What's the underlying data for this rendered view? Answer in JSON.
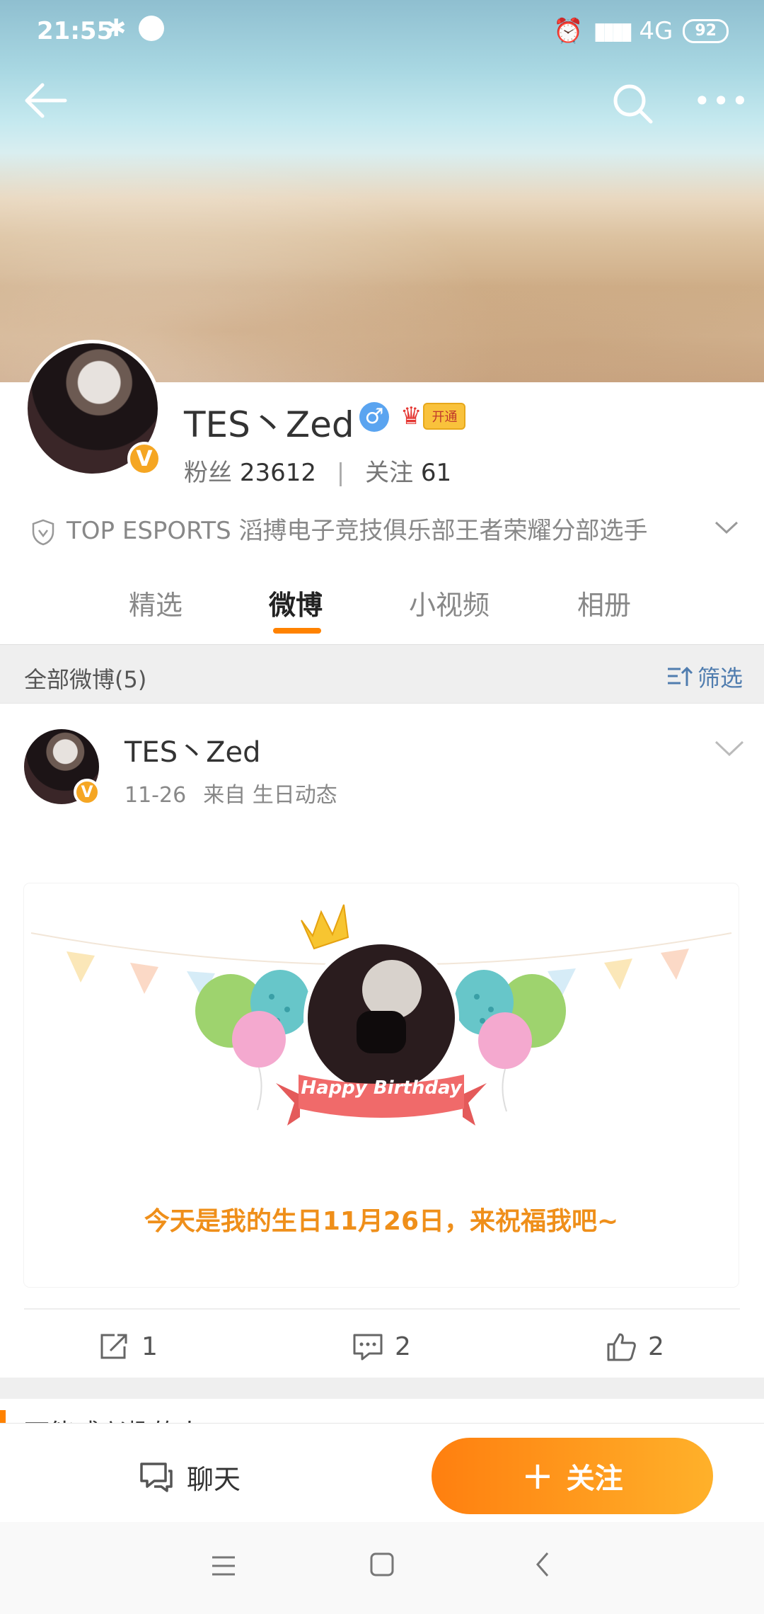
{
  "status_bar": {
    "time": "21:55",
    "network": "4G",
    "battery": "92"
  },
  "profile": {
    "name": "TES丶Zed",
    "vip_label": "开通",
    "fans_label": "粉丝",
    "fans_count": "23612",
    "following_label": "关注",
    "following_count": "61",
    "description": "TOP ESPORTS 滔搏电子竞技俱乐部王者荣耀分部选手",
    "verified_badge": "V"
  },
  "tabs": [
    "精选",
    "微博",
    "小视频",
    "相册"
  ],
  "active_tab": "微博",
  "section": {
    "title": "全部微博(5)",
    "filter_label": "筛选"
  },
  "post": {
    "author": "TES丶Zed",
    "date": "11-26",
    "source": "来自 生日动态",
    "card_text": "今天是我的生日11月26日，来祝福我吧~",
    "banner_text": "Happy Birthday",
    "reposts": "1",
    "comments": "2",
    "likes": "2"
  },
  "next_section_peek": "可能感兴趣的人",
  "bottom_bar": {
    "chat_label": "聊天",
    "follow_label": "关注"
  },
  "colors": {
    "accent": "#ff8200",
    "verified": "#f5a623",
    "link": "#507daf",
    "card_text": "#ef8f1a"
  }
}
